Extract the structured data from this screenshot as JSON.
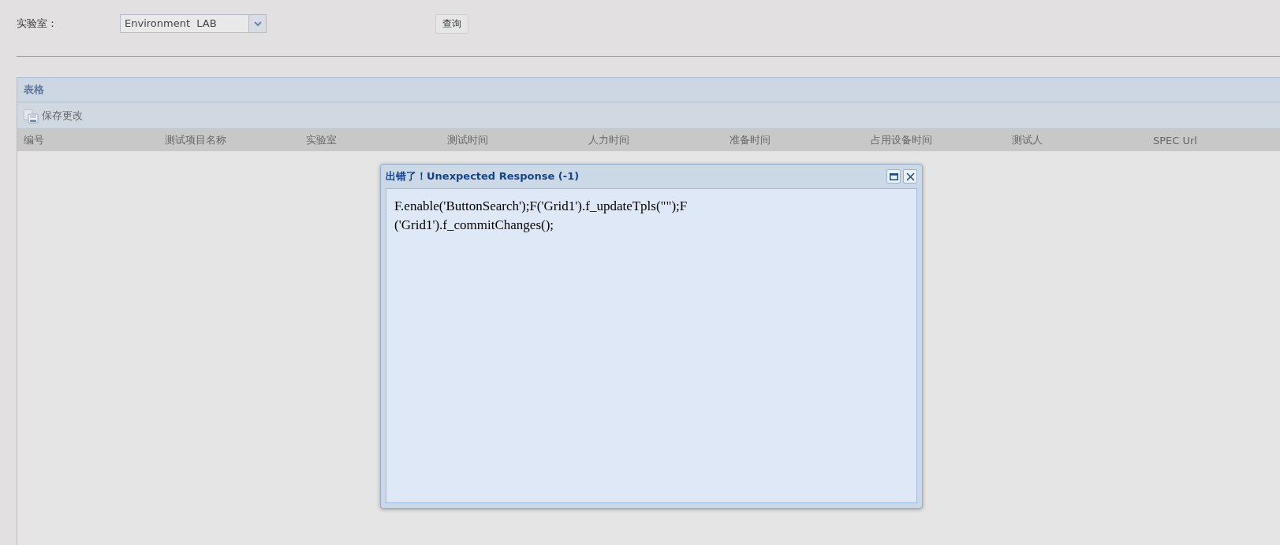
{
  "filter": {
    "label": "实验室：",
    "dropdown_value": "Environment  LAB",
    "search_button": "查询"
  },
  "panel": {
    "title": "表格",
    "toolbar": {
      "save_button": "保存更改"
    },
    "columns": [
      "编号",
      "测试项目名称",
      "实验室",
      "测试时间",
      "人力时间",
      "准备时间",
      "占用设备时间",
      "测试人",
      "SPEC Url"
    ]
  },
  "dialog": {
    "title": "出错了！Unexpected Response (-1)",
    "message": "F.enable('ButtonSearch');F('Grid1').f_updateTpls(\"\");F ('Grid1').f_commitChanges();"
  }
}
